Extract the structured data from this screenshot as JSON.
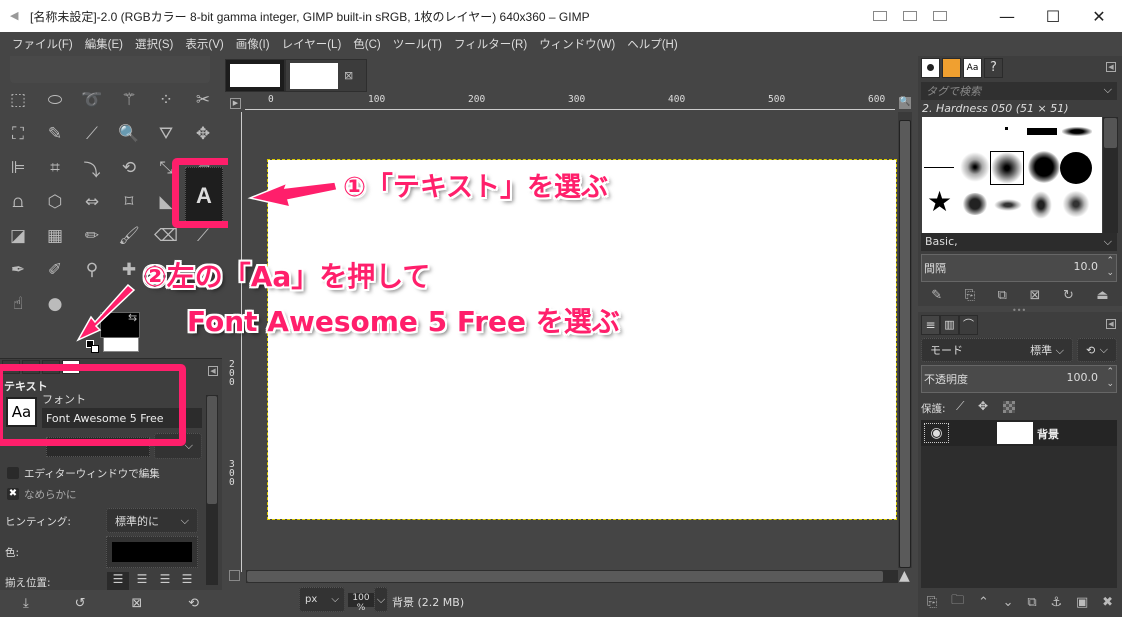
{
  "window": {
    "title": "[名称未設定]-2.0 (RGBカラー 8-bit gamma integer, GIMP built-in sRGB, 1枚のレイヤー) 640x360 – GIMP",
    "controls": {
      "minimize": "—",
      "maximize": "☐",
      "close": "✕"
    }
  },
  "menu": [
    "ファイル(F)",
    "編集(E)",
    "選択(S)",
    "表示(V)",
    "画像(I)",
    "レイヤー(L)",
    "色(C)",
    "ツール(T)",
    "フィルター(R)",
    "ウィンドウ(W)",
    "ヘルプ(H)"
  ],
  "toolbox": {
    "tools": [
      {
        "name": "rect-select",
        "glyph": "⬚"
      },
      {
        "name": "ellipse-select",
        "glyph": "⬭"
      },
      {
        "name": "free-select",
        "glyph": "➰"
      },
      {
        "name": "fuzzy-select",
        "glyph": "⚚"
      },
      {
        "name": "color-select",
        "glyph": "⁘"
      },
      {
        "name": "scissors-select",
        "glyph": "✂"
      },
      {
        "name": "foreground-select",
        "glyph": "⛶"
      },
      {
        "name": "paths",
        "glyph": "✎"
      },
      {
        "name": "color-picker",
        "glyph": "⟋"
      },
      {
        "name": "zoom",
        "glyph": "🔍"
      },
      {
        "name": "measure",
        "glyph": "⛛"
      },
      {
        "name": "move",
        "glyph": "✥"
      },
      {
        "name": "align",
        "glyph": "⊫"
      },
      {
        "name": "crop",
        "glyph": "⌗"
      },
      {
        "name": "unified-transform",
        "glyph": "⤵"
      },
      {
        "name": "rotate",
        "glyph": "⟲"
      },
      {
        "name": "scale",
        "glyph": "⤡"
      },
      {
        "name": "shear",
        "glyph": "▱"
      },
      {
        "name": "warp-transform",
        "glyph": "⩍"
      },
      {
        "name": "perspective",
        "glyph": "⬡"
      },
      {
        "name": "flip",
        "glyph": "⇔"
      },
      {
        "name": "cage-transform",
        "glyph": "⌑"
      },
      {
        "name": "handle-transform",
        "glyph": "◣"
      },
      {
        "name": "text",
        "glyph": "A"
      },
      {
        "name": "bucket-fill",
        "glyph": "◪"
      },
      {
        "name": "gradient",
        "glyph": "▦"
      },
      {
        "name": "pencil",
        "glyph": "✏"
      },
      {
        "name": "paintbrush",
        "glyph": "🖌"
      },
      {
        "name": "eraser",
        "glyph": "⌫"
      },
      {
        "name": "airbrush",
        "glyph": "⟋"
      },
      {
        "name": "ink",
        "glyph": "✒"
      },
      {
        "name": "mypaint-brush",
        "glyph": "✐"
      },
      {
        "name": "clone",
        "glyph": "⚲"
      },
      {
        "name": "heal",
        "glyph": "✚"
      },
      {
        "name": "",
        "glyph": ""
      },
      {
        "name": "",
        "glyph": ""
      },
      {
        "name": "smudge",
        "glyph": "☝"
      },
      {
        "name": "dodge-burn",
        "glyph": "●"
      }
    ],
    "colors": {
      "foreground": "#000000",
      "background": "#ffffff"
    }
  },
  "tool_options": {
    "title": "テキスト",
    "font_label": "フォント",
    "font_preview": "Aa",
    "font_value": "Font Awesome 5 Free",
    "use_editor_label": "エディターウィンドウで編集",
    "use_editor_checked": false,
    "antialias_label": "なめらかに",
    "antialias_checked": true,
    "hinting_label": "ヒンティング:",
    "hinting_value": "標準的に",
    "color_label": "色:",
    "color_value": "#000000",
    "justify_label": "揃え位置:",
    "bottom_actions": [
      "save-options",
      "restore-options",
      "delete-options",
      "reset-options"
    ]
  },
  "canvas": {
    "ruler_h": [
      "0",
      "100",
      "200",
      "300",
      "400",
      "500",
      "600"
    ],
    "ruler_v": [
      "200",
      "300"
    ],
    "unit": "px",
    "zoom": "100 %",
    "status": "背景 (2.2 MB)"
  },
  "brushes": {
    "tag_placeholder": "タグで検索",
    "selected_brush": "2. Hardness 050 (51 × 51)",
    "brush_set": "Basic,",
    "spacing_label": "間隔",
    "spacing_value": "10.0"
  },
  "layers": {
    "mode_label": "モード",
    "mode_value": "標準",
    "opacity_label": "不透明度",
    "opacity_value": "100.0",
    "lock_label": "保護:",
    "items": [
      {
        "name": "背景",
        "visible": true
      }
    ]
  },
  "annotations": {
    "step1": "①「テキスト」を選ぶ",
    "step2_line1": "②左の「Aa」を押して",
    "step2_line2": "Font Awesome 5 Free を選ぶ",
    "accent": "#ff1f6b"
  }
}
